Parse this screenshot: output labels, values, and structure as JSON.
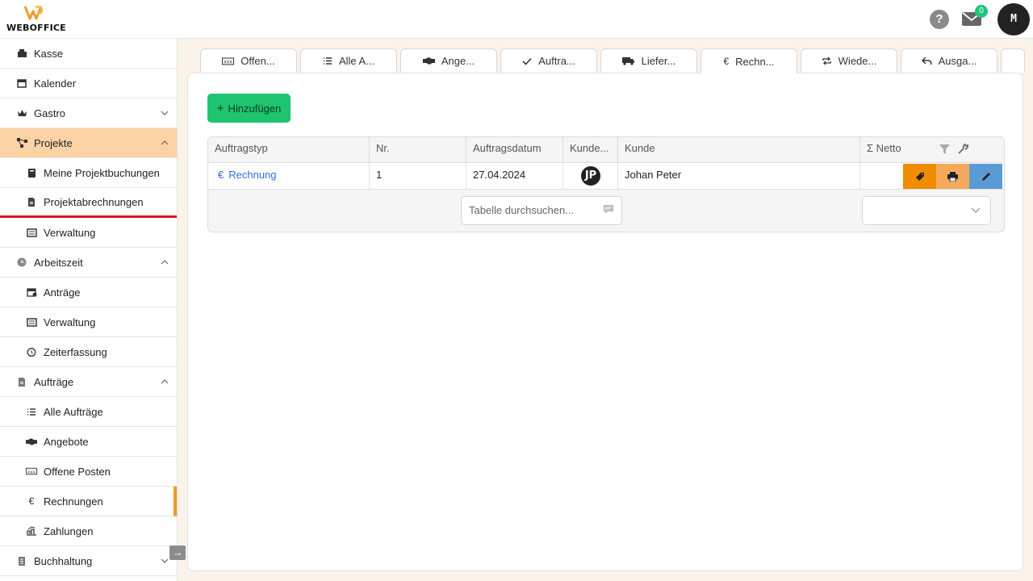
{
  "brand": {
    "name": "WEBOFFICE",
    "accent": "#f29a26"
  },
  "header": {
    "help_label": "?",
    "mail_count": "0",
    "user_initial": "M"
  },
  "sidebar": {
    "items": [
      {
        "label": "Kasse",
        "icon": "cash-register-icon"
      },
      {
        "label": "Kalender",
        "icon": "calendar-icon"
      },
      {
        "label": "Gastro",
        "icon": "crown-icon"
      },
      {
        "label": "Projekte",
        "icon": "project-diagram-icon"
      },
      {
        "label": "Meine Projektbuchungen",
        "icon": "book-icon"
      },
      {
        "label": "Projektabrechnungen",
        "icon": "file-invoice-icon"
      },
      {
        "label": "Verwaltung",
        "icon": "list-icon"
      },
      {
        "label": "Arbeitszeit",
        "icon": "clock-icon"
      },
      {
        "label": "Anträge",
        "icon": "calendar-plus-icon"
      },
      {
        "label": "Verwaltung",
        "icon": "list-icon"
      },
      {
        "label": "Zeiterfassung",
        "icon": "stopwatch-icon"
      },
      {
        "label": "Aufträge",
        "icon": "document-icon"
      },
      {
        "label": "Alle Aufträge",
        "icon": "list-ul-icon"
      },
      {
        "label": "Angebote",
        "icon": "handshake-icon"
      },
      {
        "label": "Offene Posten",
        "icon": "money-bill-icon"
      },
      {
        "label": "Rechnungen",
        "icon": "euro-icon"
      },
      {
        "label": "Zahlungen",
        "icon": "payments-icon"
      },
      {
        "label": "Buchhaltung",
        "icon": "ledger-icon"
      }
    ]
  },
  "tabs": [
    {
      "label": "Offen...",
      "icon": "money-bill-icon"
    },
    {
      "label": "Alle A...",
      "icon": "list-ul-icon"
    },
    {
      "label": "Ange...",
      "icon": "handshake-icon"
    },
    {
      "label": "Auftra...",
      "icon": "check-icon"
    },
    {
      "label": "Liefer...",
      "icon": "truck-icon"
    },
    {
      "label": "Rechn...",
      "icon": "euro-icon"
    },
    {
      "label": "Wiede...",
      "icon": "repeat-icon"
    },
    {
      "label": "Ausga...",
      "icon": "reply-icon"
    }
  ],
  "main": {
    "add_button": "Hinzufügen",
    "table": {
      "columns": [
        "Auftragstyp",
        "Nr.",
        "Auftragsdatum",
        "Kunde...",
        "Kunde",
        "Σ Netto"
      ],
      "rows": [
        {
          "type": "Rechnung",
          "nr": "1",
          "date": "27.04.2024",
          "customer_initials": "JP",
          "customer": "Johan Peter",
          "netto": ""
        }
      ]
    },
    "search_placeholder": "Tabelle durchsuchen..."
  }
}
